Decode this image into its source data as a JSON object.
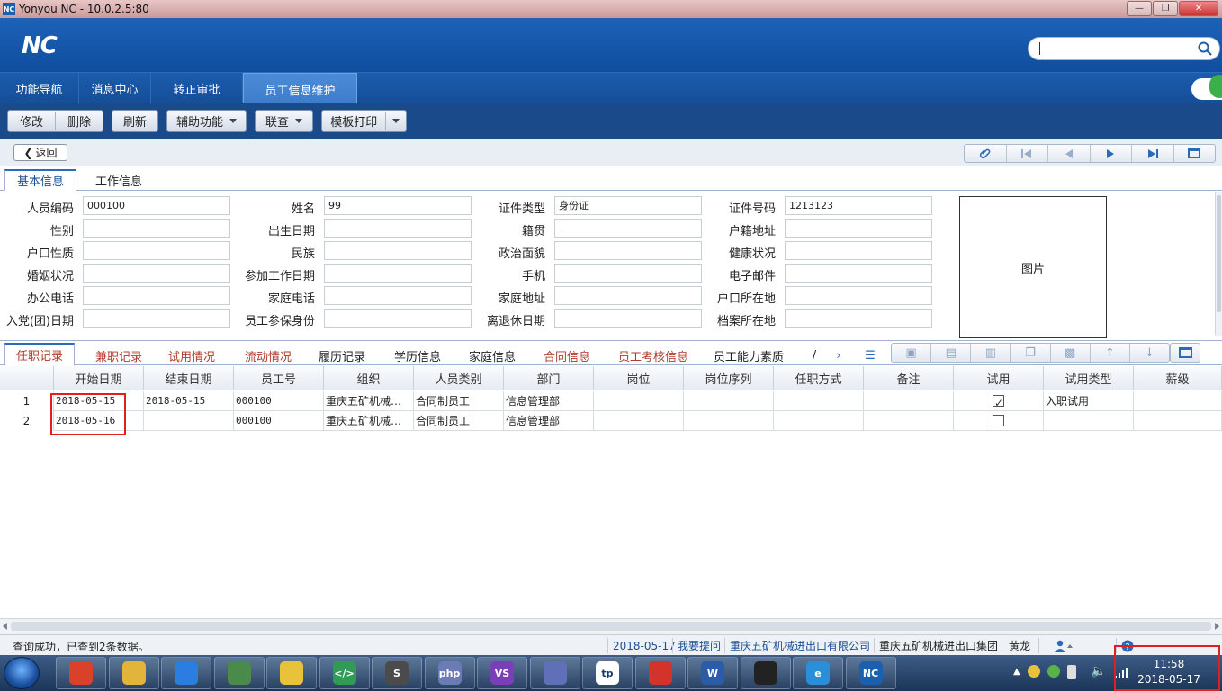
{
  "window": {
    "title": "Yonyou NC - 10.0.2.5:80",
    "app_icon_text": "NC"
  },
  "header": {
    "logo": "NC"
  },
  "nav_tabs": [
    {
      "label": "功能导航"
    },
    {
      "label": "消息中心"
    },
    {
      "label": "转正审批"
    },
    {
      "label": "员工信息维护",
      "active": true
    }
  ],
  "toolbar": {
    "edit": "修改",
    "delete": "删除",
    "refresh": "刷新",
    "assist": "辅助功能",
    "linked_query": "联查",
    "template_print": "模板打印"
  },
  "subbar": {
    "back": "返回"
  },
  "card_tabs": [
    {
      "label": "基本信息",
      "active": true
    },
    {
      "label": "工作信息"
    }
  ],
  "form": {
    "fields": [
      {
        "label": "人员编码",
        "value": "000100"
      },
      {
        "label": "姓名",
        "value": "99"
      },
      {
        "label": "证件类型",
        "value": "身份证"
      },
      {
        "label": "证件号码",
        "value": "1213123"
      },
      {
        "label": "性别",
        "value": ""
      },
      {
        "label": "出生日期",
        "value": ""
      },
      {
        "label": "籍贯",
        "value": ""
      },
      {
        "label": "户籍地址",
        "value": ""
      },
      {
        "label": "户口性质",
        "value": ""
      },
      {
        "label": "民族",
        "value": ""
      },
      {
        "label": "政治面貌",
        "value": ""
      },
      {
        "label": "健康状况",
        "value": ""
      },
      {
        "label": "婚姻状况",
        "value": ""
      },
      {
        "label": "参加工作日期",
        "value": ""
      },
      {
        "label": "手机",
        "value": ""
      },
      {
        "label": "电子邮件",
        "value": ""
      },
      {
        "label": "办公电话",
        "value": ""
      },
      {
        "label": "家庭电话",
        "value": ""
      },
      {
        "label": "家庭地址",
        "value": ""
      },
      {
        "label": "户口所在地",
        "value": ""
      },
      {
        "label": "入党(团)日期",
        "value": ""
      },
      {
        "label": "员工参保身份",
        "value": ""
      },
      {
        "label": "离退休日期",
        "value": ""
      },
      {
        "label": "档案所在地",
        "value": ""
      }
    ],
    "photo_label": "图片"
  },
  "sub_tabs": [
    {
      "label": "任职记录",
      "active": true
    },
    {
      "label": "兼职记录"
    },
    {
      "label": "试用情况"
    },
    {
      "label": "流动情况"
    },
    {
      "label": "履历记录"
    },
    {
      "label": "学历信息"
    },
    {
      "label": "家庭信息"
    },
    {
      "label": "合同信息"
    },
    {
      "label": "员工考核信息"
    },
    {
      "label": "员工能力素质"
    },
    {
      "label": "/"
    }
  ],
  "grid": {
    "columns": [
      "开始日期",
      "结束日期",
      "员工号",
      "组织",
      "人员类别",
      "部门",
      "岗位",
      "岗位序列",
      "任职方式",
      "备注",
      "试用",
      "试用类型",
      "薪级"
    ],
    "rows": [
      {
        "no": "1",
        "start": "2018-05-15",
        "end": "2018-05-15",
        "emp": "000100",
        "org": "重庆五矿机械…",
        "cat": "合同制员工",
        "dept": "信息管理部",
        "pos": "",
        "seq": "",
        "mode": "",
        "note": "",
        "trial": true,
        "trial_type": "入职试用",
        "grade": ""
      },
      {
        "no": "2",
        "start": "2018-05-16",
        "end": "",
        "emp": "000100",
        "org": "重庆五矿机械…",
        "cat": "合同制员工",
        "dept": "信息管理部",
        "pos": "",
        "seq": "",
        "mode": "",
        "note": "",
        "trial": false,
        "trial_type": "",
        "grade": ""
      }
    ]
  },
  "status": {
    "message": "查询成功，已查到2条数据。",
    "date": "2018-05-17",
    "ask": "我要提问",
    "company": "重庆五矿机械进出口有限公司",
    "group": "重庆五矿机械进出口集团",
    "user": "黄龙"
  },
  "taskbar": {
    "apps": [
      {
        "name": "chrome-icon",
        "color": "#d9412b",
        "text": ""
      },
      {
        "name": "folder-icon",
        "color": "#e2b53a",
        "text": ""
      },
      {
        "name": "baidu-netdisk-icon",
        "color": "#2b7de0",
        "text": ""
      },
      {
        "name": "network-icon",
        "color": "#4a8a4a",
        "text": ""
      },
      {
        "name": "melon-icon",
        "color": "#e8c23a",
        "text": ""
      },
      {
        "name": "code-editor-icon",
        "color": "#2f9b55",
        "text": "</>"
      },
      {
        "name": "sublime-icon",
        "color": "#4b4b4b",
        "text": "S"
      },
      {
        "name": "php-icon",
        "color": "#6a7bb5",
        "text": "php"
      },
      {
        "name": "visual-studio-icon",
        "color": "#7a3fb8",
        "text": "VS"
      },
      {
        "name": "eclipse-icon",
        "color": "#5f6fb8",
        "text": ""
      },
      {
        "name": "thinkphp-icon",
        "color": "#ffffff",
        "text": "tp"
      },
      {
        "name": "ruby-icon",
        "color": "#d3332b",
        "text": ""
      },
      {
        "name": "word-icon",
        "color": "#2a5ca8",
        "text": "W"
      },
      {
        "name": "qq-icon",
        "color": "#222222",
        "text": ""
      },
      {
        "name": "ie-icon",
        "color": "#2a8fd8",
        "text": "e"
      },
      {
        "name": "nc-icon",
        "color": "#1b5fae",
        "text": "NC"
      }
    ],
    "time": "11:58",
    "date": "2018-05-17"
  }
}
